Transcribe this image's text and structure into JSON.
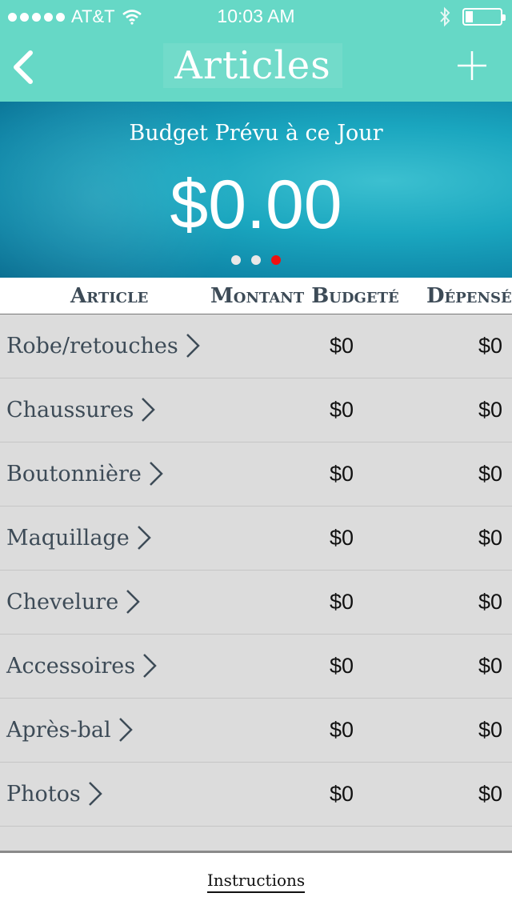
{
  "status_bar": {
    "carrier": "AT&T",
    "time": "10:03 AM",
    "icons": [
      "signal-dots",
      "wifi-icon",
      "bluetooth-icon",
      "battery-icon"
    ]
  },
  "nav": {
    "title": "Articles",
    "back_icon": "chevron-left-icon",
    "add_icon": "plus-icon"
  },
  "hero": {
    "subtitle": "Budget Prévu à ce Jour",
    "amount": "$0.00",
    "pages": 3,
    "active_page": 3
  },
  "table": {
    "headers": [
      "Article",
      "Montant Budgeté",
      "Dépensé"
    ],
    "rows": [
      {
        "name": "Robe/retouches",
        "budget": "$0",
        "spent": "$0"
      },
      {
        "name": "Chaussures",
        "budget": "$0",
        "spent": "$0"
      },
      {
        "name": "Boutonnière",
        "budget": "$0",
        "spent": "$0"
      },
      {
        "name": "Maquillage",
        "budget": "$0",
        "spent": "$0"
      },
      {
        "name": "Chevelure",
        "budget": "$0",
        "spent": "$0"
      },
      {
        "name": "Accessoires",
        "budget": "$0",
        "spent": "$0"
      },
      {
        "name": "Après-bal",
        "budget": "$0",
        "spent": "$0"
      },
      {
        "name": "Photos",
        "budget": "$0",
        "spent": "$0"
      }
    ]
  },
  "footer": {
    "link": "Instructions"
  },
  "colors": {
    "header_bg": "#66d8c6",
    "text_dark": "#3d4b57",
    "row_bg": "#dcdcdc",
    "page_active": "#ee1111"
  }
}
